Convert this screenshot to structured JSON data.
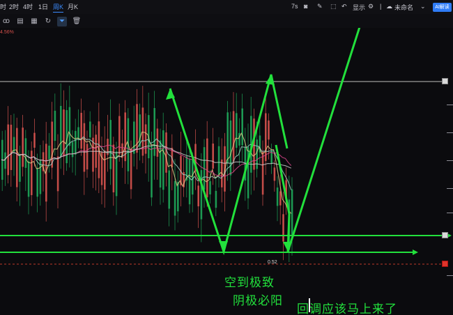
{
  "toolbar": {
    "timeframes": [
      "时",
      "2时",
      "4时",
      "1日",
      "周K",
      "月K"
    ],
    "active_timeframe": "周K",
    "icons": [
      "indicator-icon",
      "clipboard-icon",
      "calendar-icon",
      "drawing-icon",
      "filter-icon",
      "trash-icon"
    ]
  },
  "header_right": {
    "interval": "7s",
    "show_label": "显示",
    "layout_name": "未命名",
    "badge": "AI解读"
  },
  "chart": {
    "change_label": "4.56%",
    "price_label": "0.52",
    "colors": {
      "up": "#d9534f",
      "down": "#1ea85a",
      "annotation": "#22e03c",
      "ma_pink": "#e0498f",
      "resistance": "#bfbfbf",
      "support": "#22e03c"
    }
  },
  "annotations": {
    "line1": "空到极致",
    "line2": "阴极必阳",
    "line3": "回调应该马上来了"
  }
}
